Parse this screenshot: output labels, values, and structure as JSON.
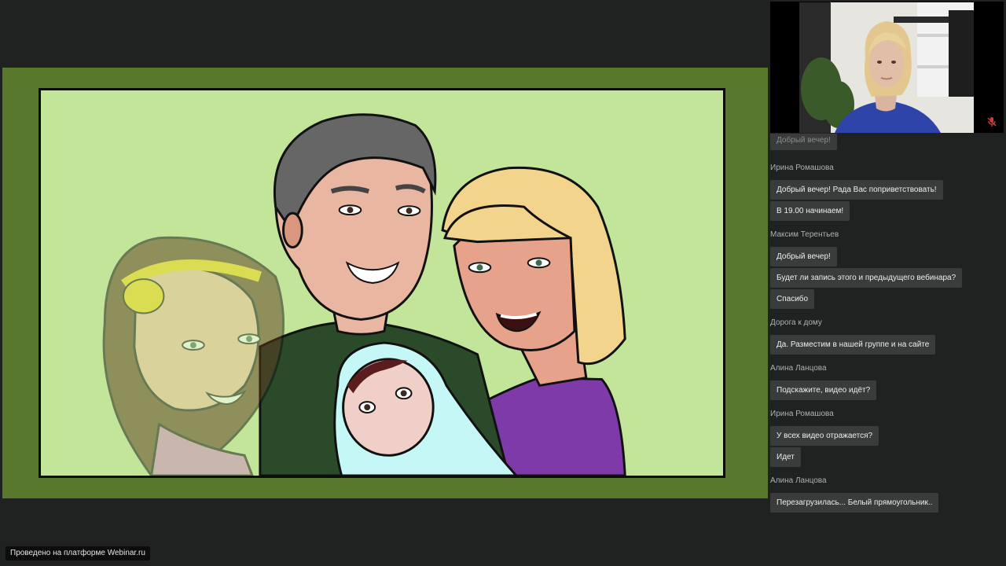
{
  "webinar": {
    "brand_label": "Проведено на платформе Webinar.ru"
  },
  "presenter_video": {
    "mic_icon": "mic-muted-icon"
  },
  "chat": {
    "partial_top_message": "Добрый вечер!",
    "groups": [
      {
        "author": "Ирина Ромашова",
        "messages": [
          "Добрый вечер! Рада Вас поприветствовать!",
          "В 19.00 начинаем!"
        ]
      },
      {
        "author": "Максим Терентьев",
        "messages": [
          "Добрый вечер!",
          "Будет ли запись этого и предыдущего вебинара?",
          "Спасибо"
        ]
      },
      {
        "author": "Дорога к дому",
        "messages": [
          "Да. Разместим в нашей группе и на сайте"
        ]
      },
      {
        "author": "Алина Ланцова",
        "messages": [
          "Подскажите, видео идёт?"
        ]
      },
      {
        "author": "Ирина Ромашова",
        "messages": [
          "У всех видео отражается?",
          "Идет"
        ]
      },
      {
        "author": "Алина Ланцова",
        "messages": [
          "Перезагрузилась... Белый прямоугольник.."
        ]
      }
    ]
  },
  "colors": {
    "background": "#1f2221",
    "stage": "#58782c",
    "slide": "#c2e59a",
    "bubble": "#3a3c3c",
    "mic_muted": "#d23a3a"
  }
}
